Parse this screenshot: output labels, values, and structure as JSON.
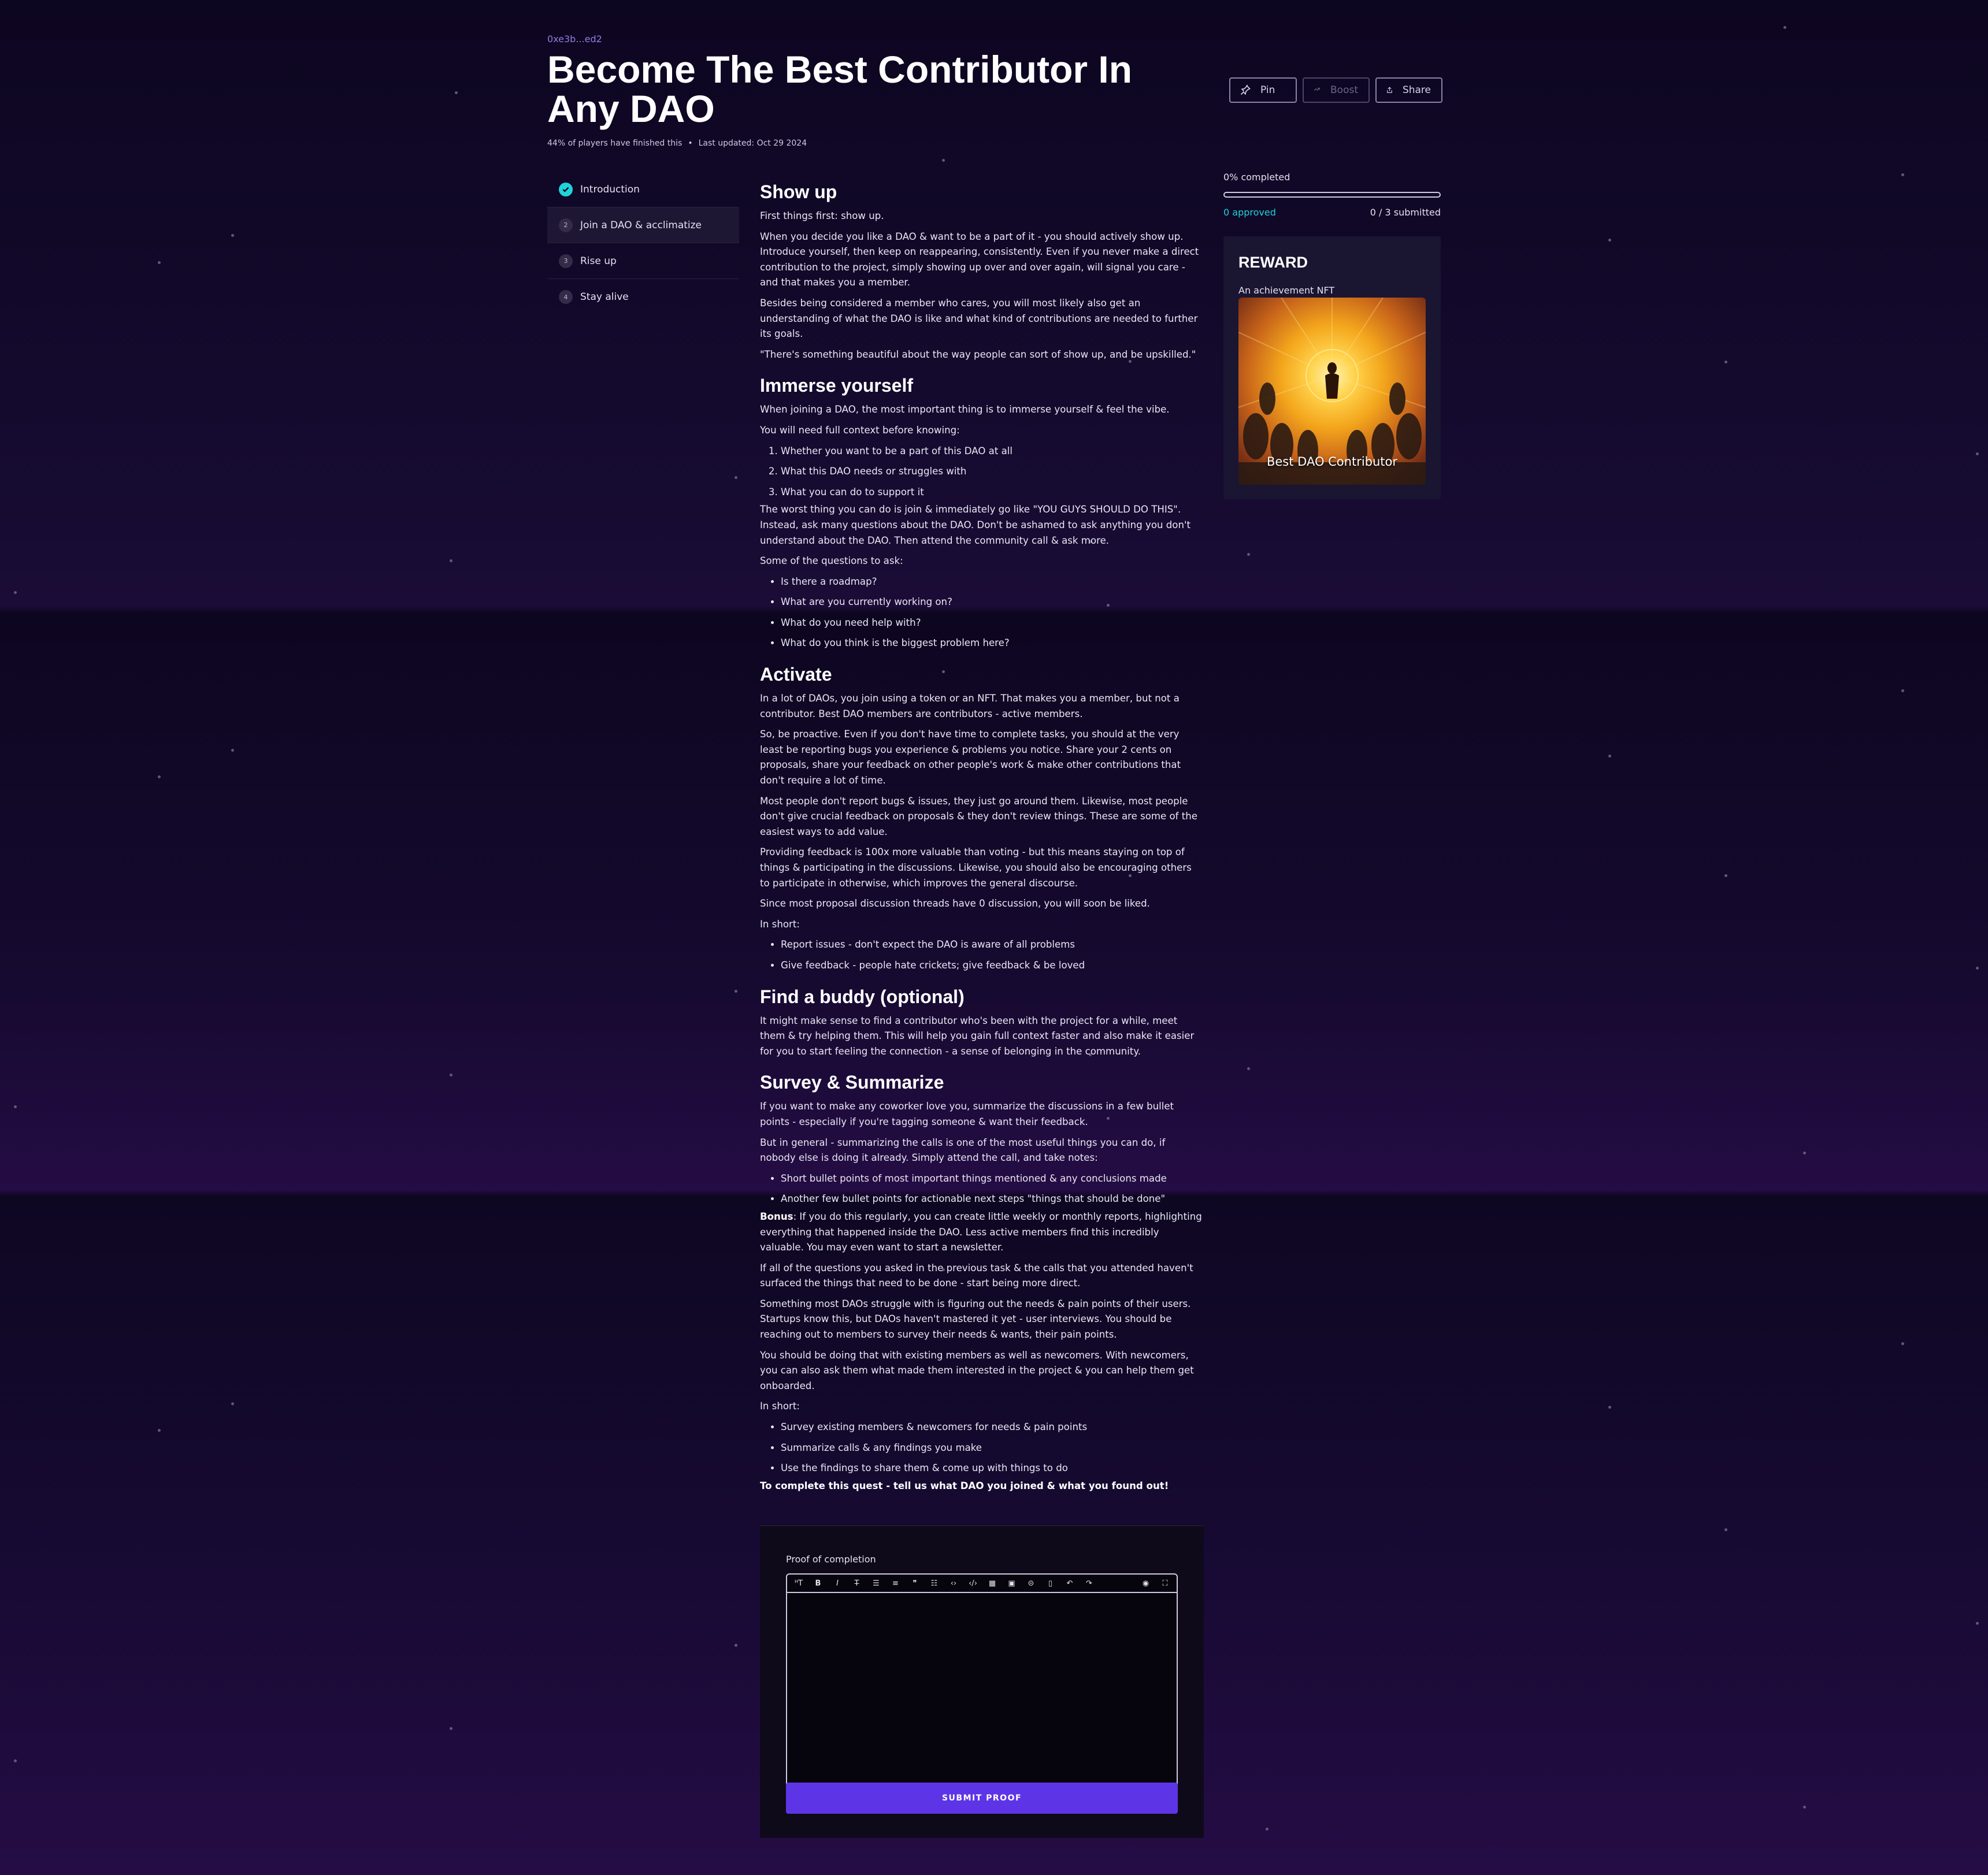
{
  "quest": {
    "creator_address": "0xe3b...ed2",
    "title": "Become The Best Contributor In Any DAO",
    "finished_stat": "44% of players have finished this",
    "last_updated": "Last updated: Oct 29 2024"
  },
  "actions": {
    "pin": "Pin",
    "boost": "Boost",
    "share": "Share"
  },
  "nav": {
    "items": [
      {
        "label": "Introduction",
        "marker": "check"
      },
      {
        "label": "Join a DAO & acclimatize",
        "marker": "2"
      },
      {
        "label": "Rise up",
        "marker": "3"
      },
      {
        "label": "Stay alive",
        "marker": "4"
      }
    ]
  },
  "content": {
    "s1": {
      "heading": "Show up",
      "p1": "First things first: show up.",
      "p2": "When you decide you like a DAO & want to be a part of it - you should actively show up. Introduce yourself, then keep on reappearing, consistently. Even if you never make a direct contribution to the project, simply showing up over and over again, will signal you care - and that makes you a member.",
      "p3": "Besides being considered a member who cares, you will most likely also get an understanding of what the DAO is like and what kind of contributions are needed to further its goals.",
      "p4": "\"There's something beautiful about the way people can sort of show up, and be upskilled.\""
    },
    "s2": {
      "heading": "Immerse yourself",
      "p1": "When joining a DAO, the most important thing is to immerse yourself & feel the vibe.",
      "p2": "You will need full context before knowing:",
      "list1": [
        "Whether you want to be a part of this DAO at all",
        "What this DAO needs or struggles with",
        "What you can do to support it"
      ],
      "p3": "The worst thing you can do is join & immediately go like \"YOU GUYS SHOULD DO THIS\". Instead, ask many questions about the DAO. Don't be ashamed to ask anything you don't understand about the DAO. Then attend the community call & ask more.",
      "p4": "Some of the questions to ask:",
      "list2": [
        "Is there a roadmap?",
        "What are you currently working on?",
        "What do you need help with?",
        "What do you think is the biggest problem here?"
      ]
    },
    "s3": {
      "heading": "Activate",
      "p1": "In a lot of DAOs, you join using a token or an NFT. That makes you a member, but not a contributor. Best DAO members are contributors - active members.",
      "p2": "So, be proactive. Even if you don't have time to complete tasks, you should at the very least be reporting bugs you experience & problems you notice. Share your 2 cents on proposals, share your feedback on other people's work & make other contributions that don't require a lot of time.",
      "p3": "Most people don't report bugs & issues, they just go around them. Likewise, most people don't give crucial feedback on proposals & they don't review things. These are some of the easiest ways to add value.",
      "p4": "Providing feedback is 100x more valuable than voting - but this means staying on top of things & participating in the discussions. Likewise, you should also be encouraging others to participate in otherwise, which improves the general discourse.",
      "p5": "Since most proposal discussion threads have 0 discussion, you will soon be liked.",
      "p6": "In short:",
      "list": [
        "Report issues - don't expect the DAO is aware of all problems",
        "Give feedback - people hate crickets; give feedback & be loved"
      ]
    },
    "s4": {
      "heading": "Find a buddy (optional)",
      "p1": "It might make sense to find a contributor who's been with the project for a while, meet them & try helping them. This will help you gain full context faster and also make it easier for you to start feeling the connection - a sense of belonging in the community."
    },
    "s5": {
      "heading": "Survey & Summarize",
      "p1": "If you want to make any coworker love you, summarize the discussions in a few bullet points - especially if you're tagging someone & want their feedback.",
      "p2": "But in general - summarizing the calls is one of the most useful things you can do, if nobody else is doing it already. Simply attend the call, and take notes:",
      "list1": [
        "Short bullet points of most important things mentioned & any conclusions made",
        "Another few bullet points for actionable next steps \"things that should be done\""
      ],
      "bonus_label": "Bonus",
      "bonus_text": ": If you do this regularly, you can create little weekly or monthly reports, highlighting everything that happened inside the DAO. Less active members find this incredibly valuable. You may even want to start a newsletter.",
      "p3": "If all of the questions you asked in the previous task & the calls that you attended haven't surfaced the things that need to be done - start being more direct.",
      "p4": "Something most DAOs struggle with is figuring out the needs & pain points of their users. Startups know this, but DAOs haven't mastered it yet - user interviews. You should be reaching out to members to survey their needs & wants, their pain points.",
      "p5": "You should be doing that with existing members as well as newcomers. With newcomers, you can also ask them what made them interested in the project & you can help them get onboarded.",
      "p6": "In short:",
      "list2": [
        "Survey existing members & newcomers for needs & pain points",
        "Summarize calls & any findings you make",
        "Use the findings to share them & come up with things to do"
      ],
      "final": "To complete this quest - tell us what DAO you joined & what you found out!"
    }
  },
  "proof": {
    "label": "Proof of completion",
    "toolbar": [
      "heading-icon",
      "bold-icon",
      "italic-icon",
      "strikethrough-icon",
      "bullet-list-icon",
      "numbered-list-icon",
      "quote-icon",
      "checklist-icon",
      "code-icon",
      "code-block-icon",
      "table-icon",
      "image-icon",
      "link-icon",
      "clear-icon",
      "undo-icon",
      "redo-icon",
      "preview-icon",
      "fullscreen-icon"
    ],
    "submit": "SUBMIT PROOF"
  },
  "progress": {
    "completed_label": "0% completed",
    "completed_fraction": 0,
    "approved": "0 approved",
    "submitted": "0 / 3 submitted"
  },
  "reward": {
    "heading": "REWARD",
    "subtitle": "An achievement NFT",
    "nft_name": "Best DAO Contributor"
  },
  "colors": {
    "accent_cyan": "#20d3d9",
    "accent_purple": "#5d35e6",
    "address_purple": "#8f7ee0",
    "background": "#0d0620"
  }
}
